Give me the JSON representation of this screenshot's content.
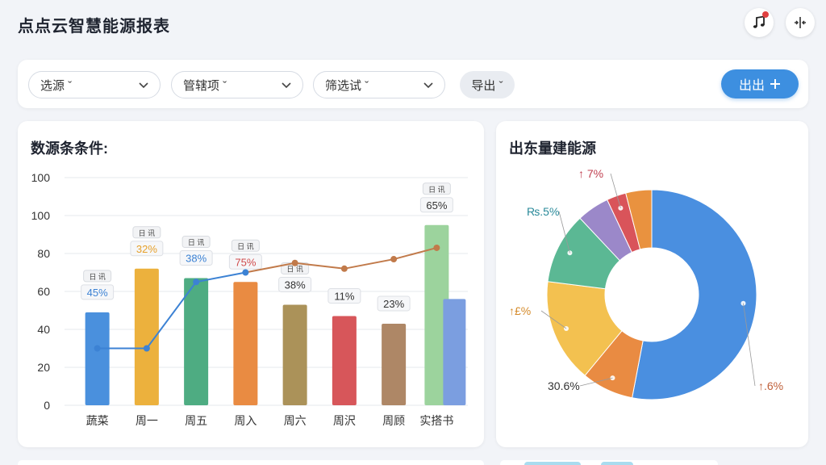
{
  "header": {
    "title": "点点云智慧能源报表",
    "music_icon": "music-note-icon",
    "split_icon": "split-view-icon"
  },
  "filters": {
    "select1": "选源 ˇ",
    "select2": "管辖项 ˇ",
    "select3": "筛选试 ˇ",
    "export_label": "导出 ˇ",
    "primary_label": "出出",
    "primary_icon": "plus-icon"
  },
  "bar_card": {
    "title": "数源条条件:"
  },
  "pie_card": {
    "title": "出东量建能源"
  },
  "colors": {
    "accent": "#3d8fe0",
    "line": "#c17a4a"
  },
  "chart_data": [
    {
      "type": "bar",
      "title": "数源条条件:",
      "y_ticks": [
        "0",
        "20",
        "40",
        "60",
        "80",
        "100",
        "100"
      ],
      "ylim": [
        0,
        100
      ],
      "categories": [
        "蔬菜",
        "周一",
        "周五",
        "周入",
        "周六",
        "周沢",
        "周顾",
        "实搭书"
      ],
      "values": [
        49,
        72,
        67,
        65,
        53,
        47,
        43,
        95
      ],
      "second_bar": {
        "category": "实搭书",
        "value": 56,
        "color": "#7b9ee0"
      },
      "bar_colors": [
        "#4a90dd",
        "#ecb13d",
        "#4eac82",
        "#e98b42",
        "#ab9259",
        "#d7565a",
        "#ae8766",
        "#9cd39d"
      ],
      "data_labels": [
        "45%",
        "32%",
        "38%",
        "75%",
        "38%",
        "11%",
        "23%",
        "65%"
      ],
      "label_colors": [
        "#3c82d4",
        "#e6a02a",
        "#3c82d4",
        "#d04a4a",
        "#333333",
        "#333333",
        "#333333",
        "#333333"
      ],
      "tag_tops": [
        "日 讯",
        "日 讯",
        "日 讯",
        "日 讯",
        "日 讯",
        "",
        "",
        "日 讯"
      ],
      "line_series": {
        "color": "#c17a4a",
        "values": [
          30,
          30,
          65,
          70,
          75,
          72,
          77,
          83
        ],
        "first_segment_color": "#3c82d4"
      },
      "grid": true
    },
    {
      "type": "pie",
      "title": "出东量建能源",
      "donut": true,
      "slices": [
        {
          "label": "↑.6%",
          "value": 53,
          "color": "#4a8fe0",
          "label_color": "#c0603a"
        },
        {
          "label": "30.6%",
          "value": 8,
          "color": "#e98b42",
          "label_color": "#333333"
        },
        {
          "label": "↑£%",
          "value": 16,
          "color": "#f3c150",
          "label_color": "#d48a2a"
        },
        {
          "label": "₨.5%",
          "value": 11,
          "color": "#5bb894",
          "label_color": "#2a8a9a"
        },
        {
          "label": "",
          "value": 5,
          "color": "#9b88c9",
          "label_color": "#333333"
        },
        {
          "label": "↑ 7%",
          "value": 3,
          "color": "#d9545a",
          "label_color": "#c04050"
        },
        {
          "label": "",
          "value": 4,
          "color": "#e9923f",
          "label_color": "#333333"
        }
      ]
    }
  ]
}
